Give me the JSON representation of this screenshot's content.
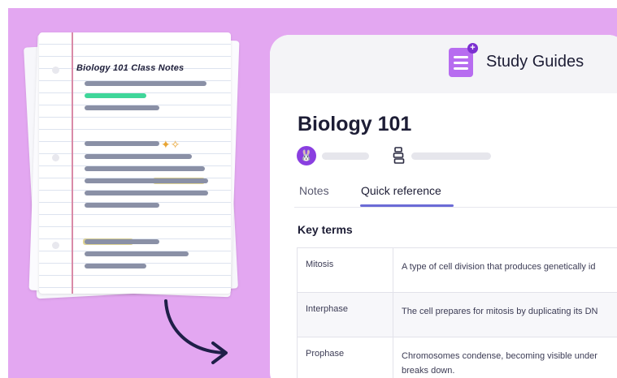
{
  "notebook": {
    "title": "Biology 101 Class Notes"
  },
  "header": {
    "icon": "study-guide-icon",
    "title": "Study Guides"
  },
  "guide": {
    "title": "Biology 101",
    "avatar_icon": "bunny-avatar-icon",
    "meta_icon": "books-icon"
  },
  "tabs": [
    {
      "label": "Notes",
      "active": false
    },
    {
      "label": "Quick reference",
      "active": true
    }
  ],
  "section": {
    "title": "Key terms"
  },
  "terms": [
    {
      "term": "Mitosis",
      "definition": "A type of cell division that produces genetically id"
    },
    {
      "term": "Interphase",
      "definition": "The cell prepares for mitosis by duplicating its DN"
    },
    {
      "term": "Prophase",
      "definition": "Chromosomes condense, becoming visible under",
      "definition_line2": "breaks down."
    }
  ],
  "colors": {
    "background": "#e3a7f1",
    "accent": "#6b6bd6",
    "icon_purple": "#b76cf0",
    "highlight_green": "#3fd69a"
  }
}
